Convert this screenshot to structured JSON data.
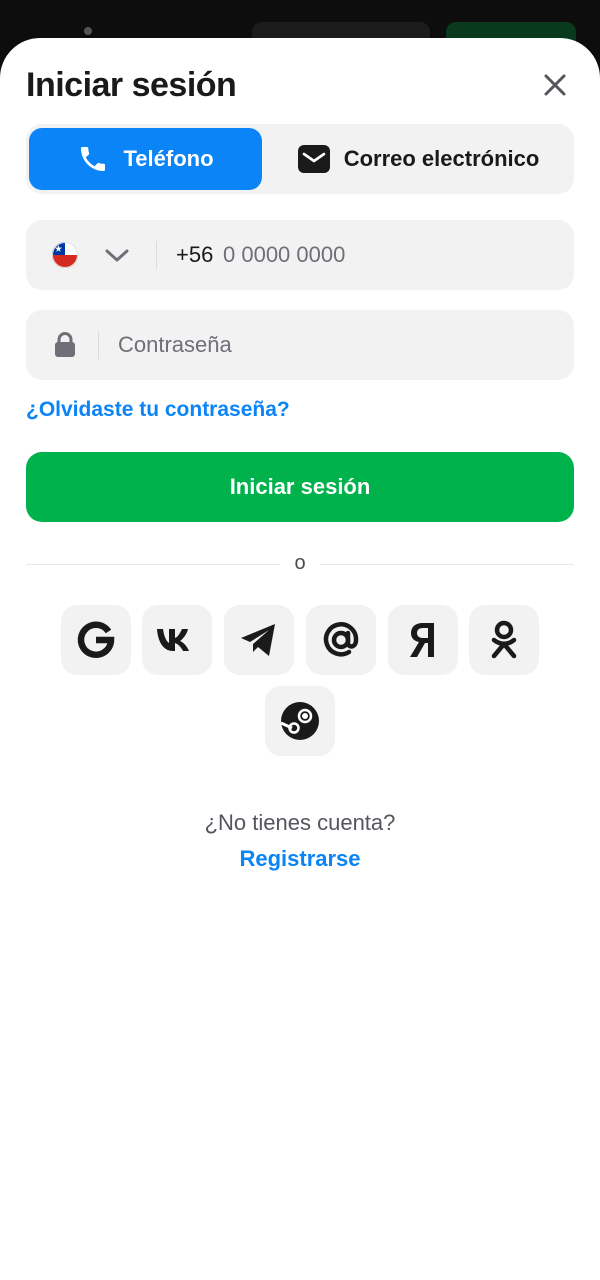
{
  "modal": {
    "title": "Iniciar sesión"
  },
  "tabs": [
    {
      "label": "Teléfono",
      "icon": "phone-icon",
      "active": true
    },
    {
      "label": "Correo electrónico",
      "icon": "envelope-icon",
      "active": false
    }
  ],
  "phone_field": {
    "country_icon": "chile-flag-icon",
    "prefix": "+56",
    "placeholder": "0 0000 0000"
  },
  "password_field": {
    "icon": "lock-icon",
    "placeholder": "Contraseña"
  },
  "forgot_link": "¿Olvidaste tu contraseña?",
  "submit_label": "Iniciar sesión",
  "separator": "o",
  "social_buttons": [
    "google-icon",
    "vk-icon",
    "telegram-icon",
    "mail-ru-icon",
    "yandex-icon",
    "odnoklassniki-icon",
    "steam-icon"
  ],
  "footer": {
    "no_account": "¿No tienes cuenta?",
    "register": "Registrarse"
  },
  "colors": {
    "accent_blue": "#0a84f7",
    "submit_green": "#00b24c",
    "field_bg": "#f2f2f3"
  }
}
